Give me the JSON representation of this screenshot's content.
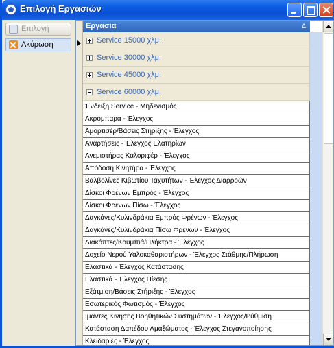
{
  "window": {
    "title": "Επιλογή Εργασιών"
  },
  "toolbar": {
    "select_label": "Επιλογή",
    "cancel_label": "Ακύρωση"
  },
  "grid": {
    "column_header": "Εργασία",
    "sort_indicator": "Δ",
    "groups": [
      {
        "label": "Service 15000 χλμ.",
        "expanded": false
      },
      {
        "label": "Service 30000 χλμ.",
        "expanded": false
      },
      {
        "label": "Service 45000 χλμ.",
        "expanded": false
      },
      {
        "label": "Service 60000 χλμ.",
        "expanded": true
      }
    ],
    "rows": [
      "Ένδειξη Service - Μηδενισμός",
      "Ακρόμπαρα - Έλεγχος",
      "Αμορτισέρ/Βάσεις Στήριξης - Έλεγχος",
      "Αναρτήσεις - Έλεγχος Ελατηρίων",
      "Ανεμιστήρας Καλοριφέρ - Έλεγχος",
      "Απόδοση Κινητήρα - Έλεγχος",
      "Βαλβολίνες Κιβωτίου Ταχυτήτων - Έλεγχος Διαρροών",
      "Δίσκοι Φρένων Εμπρός - Έλεγχος",
      "Δίσκοι Φρένων Πίσω - Έλεγχος",
      "Δαγκάνες/Κυλινδράκια Εμπρός Φρένων - Έλεγχος",
      "Δαγκάνες/Κυλινδράκια Πίσω Φρένων - Έλεγχος",
      "Διακόπτες/Κουμπιά/Πλήκτρα - Έλεγχος",
      "Δοχείο Νερού Υαλοκαθαριστήρων - Έλεγχος Στάθμης/Πλήρωση",
      "Ελαστικά - Έλεγχος Κατάστασης",
      "Ελαστικά - Έλεγχος Πίεσης",
      "Εξάτμιση/Βάσεις Στήριξης - Έλεγχος",
      "Εσωτερικός Φωτισμός - Έλεγχος",
      "Ιμάντες Κίνησης Βοηθητικών Συστημάτων - Έλεγχος/Ρύθμιση",
      "Κατάσταση Δαπέδου Αμαξώματος - Έλεγχος Στεγανοποίησης",
      "Κλειδαριές - Έλεγχος"
    ]
  },
  "colors": {
    "title_bar": "#0A4FD3",
    "header": "#2F65BD",
    "group_text": "#3A6AB8",
    "stripe": "#C9DAF3"
  },
  "icons": {
    "window": "app-icon",
    "select": "disk-icon",
    "cancel": "close-x-icon"
  }
}
